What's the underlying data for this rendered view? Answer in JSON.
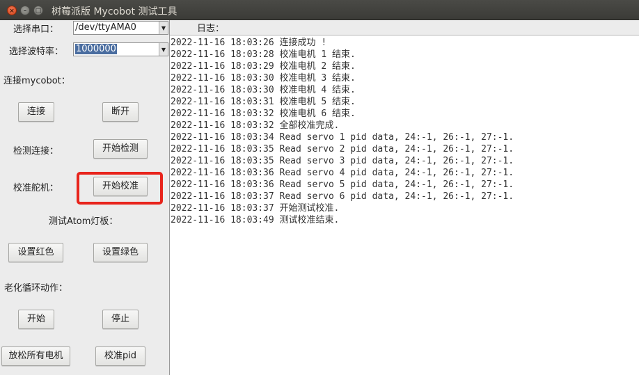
{
  "window": {
    "title": "树莓派版 Mycobot 测试工具",
    "buttons": {
      "close": "×",
      "minimize": "–",
      "maximize": "□"
    }
  },
  "controls": {
    "serial_port": {
      "label": "选择串口：",
      "value": "/dev/ttyAMA0"
    },
    "baud_rate": {
      "label": "选择波特率：",
      "value": "1000000"
    },
    "connect_section": {
      "label": "连接mycobot：",
      "connect_button": "连接",
      "disconnect_button": "断开"
    },
    "detect_section": {
      "label": "检测连接：",
      "button": "开始检测"
    },
    "calibrate_section": {
      "label": "校准舵机：",
      "button": "开始校准"
    },
    "led_section": {
      "label": "测试Atom灯板：",
      "red_button": "设置红色",
      "green_button": "设置绿色"
    },
    "aging_section": {
      "label": "老化循环动作：",
      "start_button": "开始",
      "stop_button": "停止"
    },
    "bottom": {
      "release_button": "放松所有电机",
      "calibrate_pid_button": "校准pid"
    }
  },
  "log": {
    "label": "日志：",
    "lines": [
      "2022-11-16 18:03:26 连接成功 !",
      "2022-11-16 18:03:28 校准电机 1 结束.",
      "2022-11-16 18:03:29 校准电机 2 结束.",
      "2022-11-16 18:03:30 校准电机 3 结束.",
      "2022-11-16 18:03:30 校准电机 4 结束.",
      "2022-11-16 18:03:31 校准电机 5 结束.",
      "2022-11-16 18:03:32 校准电机 6 结束.",
      "2022-11-16 18:03:32 全部校准完成.",
      "2022-11-16 18:03:34 Read servo 1 pid data, 24:-1, 26:-1, 27:-1.",
      "2022-11-16 18:03:35 Read servo 2 pid data, 24:-1, 26:-1, 27:-1.",
      "2022-11-16 18:03:35 Read servo 3 pid data, 24:-1, 26:-1, 27:-1.",
      "2022-11-16 18:03:36 Read servo 4 pid data, 24:-1, 26:-1, 27:-1.",
      "2022-11-16 18:03:36 Read servo 5 pid data, 24:-1, 26:-1, 27:-1.",
      "2022-11-16 18:03:37 Read servo 6 pid data, 24:-1, 26:-1, 27:-1.",
      "2022-11-16 18:03:37 开始测试校准.",
      "2022-11-16 18:03:49 测试校准结束."
    ]
  },
  "colors": {
    "highlight": "#e8241c",
    "titlebar": "#3f3f3b",
    "close_button": "#e0552a"
  }
}
